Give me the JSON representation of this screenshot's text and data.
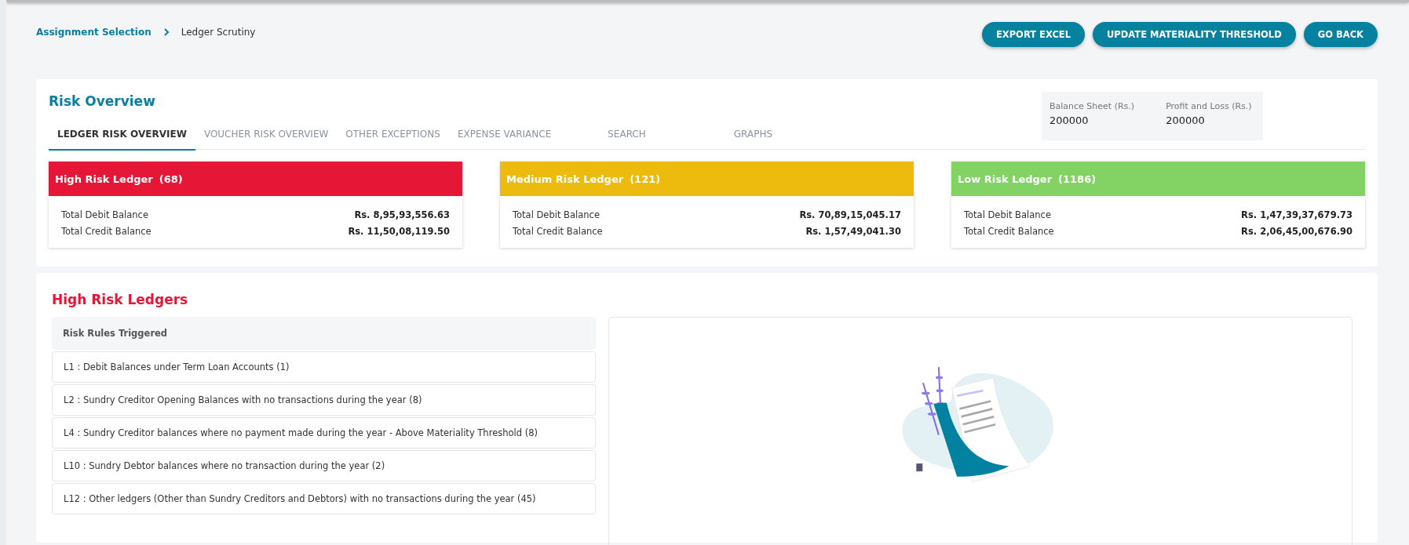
{
  "breadcrumb": [
    {
      "label": "Assignment Selection",
      "kind": "link"
    },
    {
      "label": "Ledger Scrutiny",
      "kind": "current"
    }
  ],
  "actions": [
    "EXPORT EXCEL",
    "UPDATE MATERIALITY THRESHOLD",
    "GO BACK"
  ],
  "risk_overview": {
    "title": "Risk Overview",
    "tabs": [
      {
        "label": "LEDGER RISK OVERVIEW",
        "selected": true
      },
      {
        "label": "VOUCHER RISK OVERVIEW",
        "selected": false
      },
      {
        "label": "OTHER EXCEPTIONS",
        "selected": false
      },
      {
        "label": "EXPENSE VARIANCE",
        "selected": false
      },
      {
        "label": "SEARCH",
        "selected": false
      },
      {
        "label": "GRAPHS",
        "selected": false
      }
    ],
    "thresholds": [
      {
        "label": "Balance Sheet (Rs.)",
        "value": "200000"
      },
      {
        "label": "Profit and Loss (Rs.)",
        "value": "200000"
      }
    ],
    "cards": [
      {
        "title": "High Risk Ledger",
        "count": "(68)",
        "color": "#e51636",
        "rows": [
          {
            "label": "Total Debit Balance",
            "value": "Rs. 8,95,93,556.63"
          },
          {
            "label": "Total Credit Balance",
            "value": "Rs. 11,50,08,119.50"
          }
        ]
      },
      {
        "title": "Medium Risk Ledger",
        "count": "(121)",
        "color": "#ecbb0d",
        "rows": [
          {
            "label": "Total Debit Balance",
            "value": "Rs. 70,89,15,045.17"
          },
          {
            "label": "Total Credit Balance",
            "value": "Rs. 1,57,49,041.30"
          }
        ]
      },
      {
        "title": "Low Risk Ledger",
        "count": "(1186)",
        "color": "#82d364",
        "rows": [
          {
            "label": "Total Debit Balance",
            "value": "Rs. 1,47,39,37,679.73"
          },
          {
            "label": "Total Credit Balance",
            "value": "Rs. 2,06,45,00,676.90"
          }
        ]
      }
    ]
  },
  "high_risk_ledgers": {
    "title": "High Risk Ledgers",
    "list_header": "Risk Rules Triggered",
    "rules": [
      "L1 : Debit Balances under Term Loan Accounts (1)",
      "L2 : Sundry Creditor Opening Balances with no transactions during the year (8)",
      "L4 : Sundry Creditor balances where no payment made during the year - Above Materiality Threshold (8)",
      "L10 : Sundry Debtor balances where no transaction during the year (2)",
      "L12 : Other ledgers (Other than Sundry Creditors and Debtors) with no transactions during the year (45)"
    ]
  }
}
